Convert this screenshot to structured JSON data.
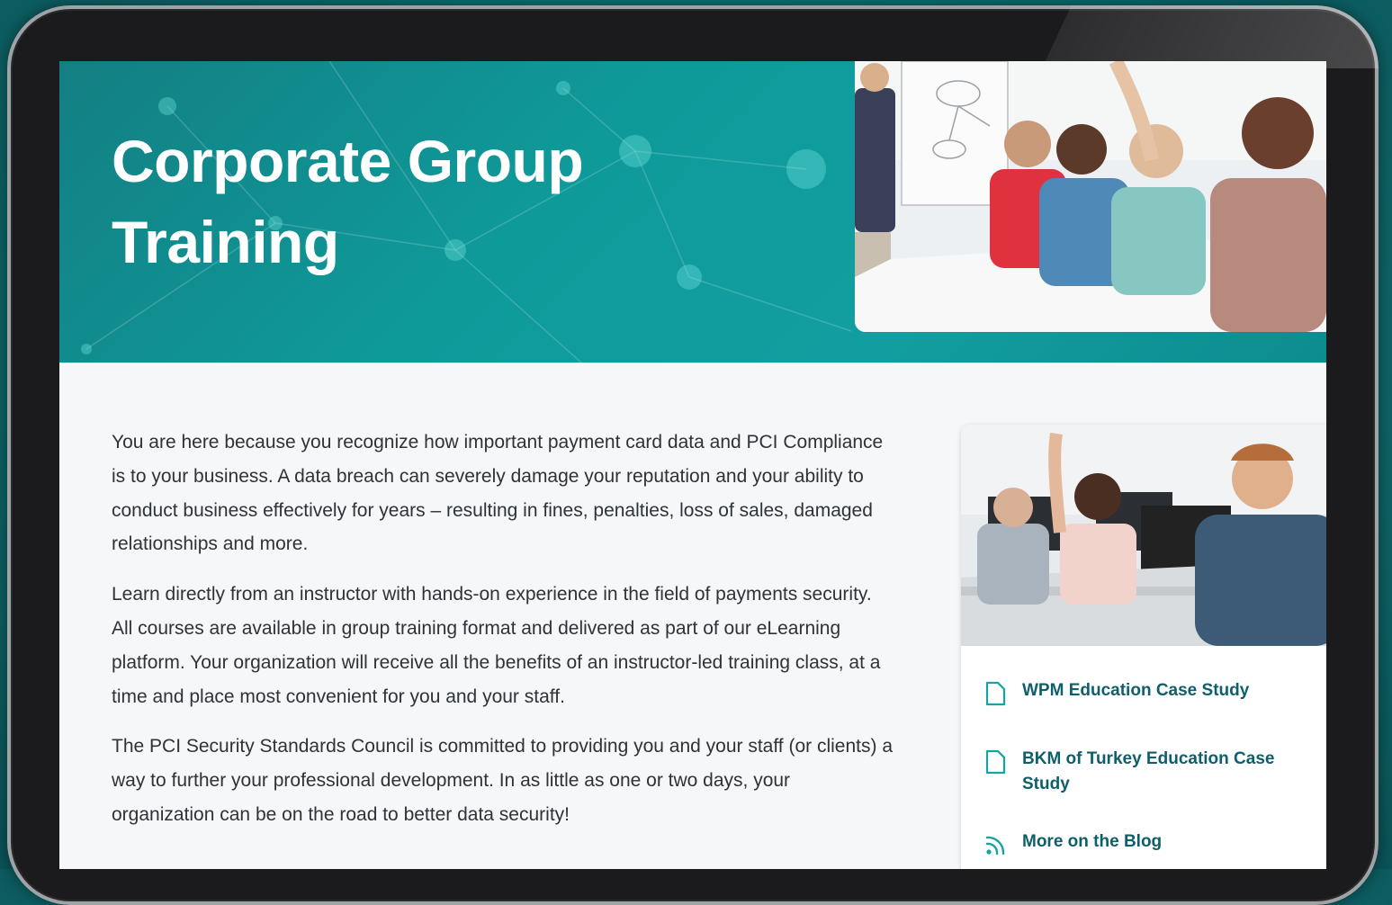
{
  "hero": {
    "title": "Corporate Group Training"
  },
  "intro": {
    "paragraphs": [
      "You are here because you recognize how important payment card data and PCI Compliance is to your business. A data breach can severely damage your reputation and your ability to conduct business effectively for years – resulting in fines, penalties, loss of sales, damaged relationships and more.",
      "Learn directly from an instructor with hands-on experience in the field of payments security. All courses are available in group training format and delivered as part of our eLearning platform. Your organization will receive all the benefits of an instructor-led training class, at a time and place most convenient for you and your staff.",
      "The PCI Security Standards Council is committed to providing you and your staff (or clients) a way to further your professional development. In as little as one or two days, your organization can be on the road to better data security!"
    ]
  },
  "sidebar": {
    "links": [
      {
        "label": "WPM Education Case Study",
        "icon": "document-icon"
      },
      {
        "label": "BKM of Turkey Education Case Study",
        "icon": "document-icon"
      },
      {
        "label": "More on the Blog",
        "icon": "rss-icon"
      }
    ]
  },
  "colors": {
    "hero_teal": "#129ea0",
    "link_color": "#0e5f6b",
    "text_color": "#2e3338",
    "page_bg": "#f6f7f9"
  }
}
